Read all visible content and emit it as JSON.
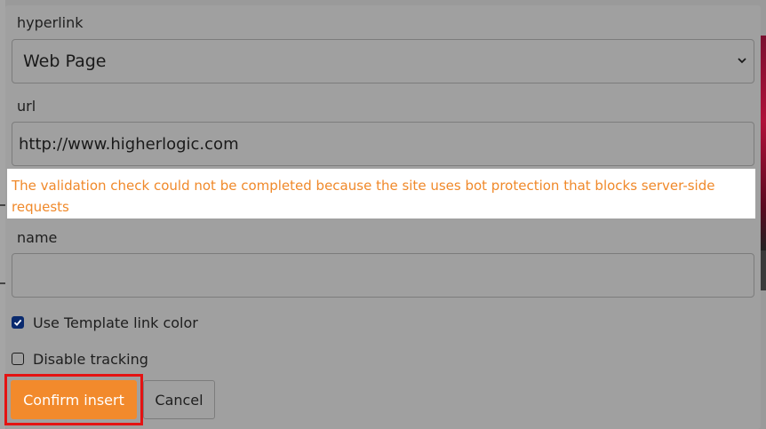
{
  "dialog": {
    "hyperlink": {
      "label": "hyperlink",
      "selected": "Web Page"
    },
    "url": {
      "label": "url",
      "value": "http://www.higherlogic.com"
    },
    "validation_error": "The validation check could not be completed because the site uses bot protection that blocks server-side requests",
    "name": {
      "label": "name",
      "value": ""
    },
    "use_template_link_color": {
      "label": "Use Template link color",
      "checked": true
    },
    "disable_tracking": {
      "label": "Disable tracking",
      "checked": false
    },
    "buttons": {
      "confirm": "Confirm insert",
      "cancel": "Cancel"
    }
  },
  "colors": {
    "overlay_gray": "#a0a0a0",
    "accent_orange": "#f28a2c",
    "error_text": "#f0892a",
    "highlight_red": "#e41212",
    "checkbox_checked": "#0a2a6e"
  },
  "icons": {
    "select_arrow": "chevron-down-icon",
    "check": "check-icon"
  }
}
